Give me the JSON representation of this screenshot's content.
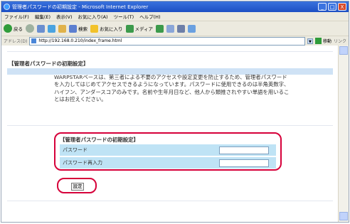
{
  "window": {
    "title": "管理者パスワードの初期設定 - Microsoft Internet Explorer",
    "controls": {
      "minimize": "_",
      "maximize": "□",
      "close": "X"
    }
  },
  "menu": [
    "ファイル(F)",
    "編集(E)",
    "表示(V)",
    "お気に入り(A)",
    "ツール(T)",
    "ヘルプ(H)"
  ],
  "toolbar": {
    "back": "戻る",
    "search": "検索",
    "favorites": "お気に入り",
    "media": "メディア"
  },
  "address": {
    "label": "アドレス(D)",
    "value": "http://192.168.0.210/index_frame.html",
    "go": "移動",
    "links": "リンク"
  },
  "page": {
    "heading": "【管理者パスワードの初期設定】",
    "description": "WARPSTARベースは、第三者による不要のアクセスや設定変更を防止するため、管理者パスワードを入力してはじめてアクセスできるようになっています。パスワードに使用できるのは半角英数字、ハイフン、アンダースコアのみです。名前や生年月日など、他人から類推されやすい単語を用いることはお控えください。"
  },
  "form": {
    "title": "【管理者パスワードの初期設定】",
    "password_label": "パスワード",
    "password_confirm_label": "パスワード再入力",
    "submit_label": "設定"
  }
}
